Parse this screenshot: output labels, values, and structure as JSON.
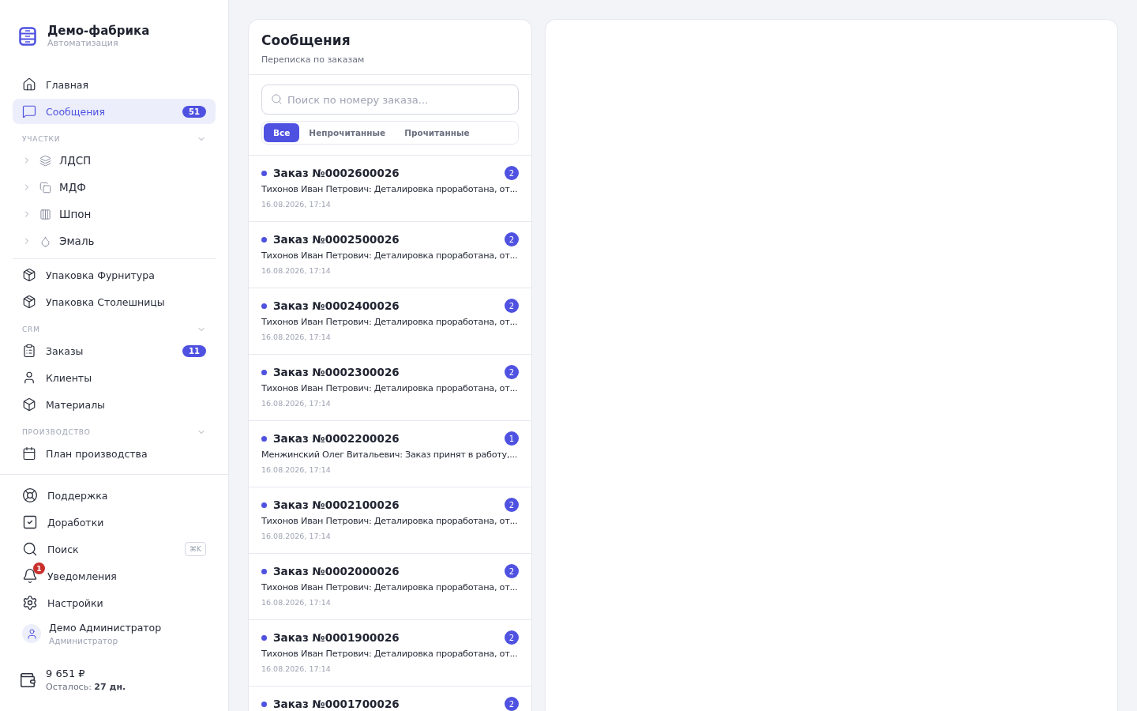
{
  "brand": {
    "title": "Демо-фабрика",
    "subtitle": "Автоматизация"
  },
  "nav": [
    {
      "label": "Главная",
      "selected": false
    },
    {
      "label": "Сообщения",
      "selected": true,
      "badge": "51"
    }
  ],
  "sections": [
    {
      "title": "УЧАСТКИ",
      "expanded": true,
      "items": [
        {
          "label": "ЛДСП",
          "expanded": false
        },
        {
          "label": "МДФ",
          "expanded": false
        },
        {
          "label": "Шпон",
          "expanded": false
        },
        {
          "label": "Эмаль",
          "expanded": false
        }
      ]
    }
  ],
  "packing": [
    {
      "label": "Упаковка Фурнитура",
      "selected": false
    },
    {
      "label": "Упаковка Столешницы",
      "selected": false
    }
  ],
  "crm": {
    "title": "CRM",
    "expanded": true,
    "items": [
      {
        "label": "Заказы",
        "selected": false,
        "badge": "11"
      },
      {
        "label": "Клиенты",
        "selected": false
      },
      {
        "label": "Материалы",
        "selected": false
      }
    ]
  },
  "production": {
    "title": "ПРОИЗВОДСТВО",
    "expanded": true,
    "items": [
      {
        "label": "План производства",
        "selected": false
      }
    ]
  },
  "bottom": [
    {
      "label": "Поддержка"
    },
    {
      "label": "Доработки"
    },
    {
      "label": "Поиск",
      "shortcut": "⌘K"
    },
    {
      "label": "Уведомления",
      "badge": "1"
    },
    {
      "label": "Настройки"
    }
  ],
  "user": {
    "name": "Демо Администратор",
    "role": "Администратор"
  },
  "balance": {
    "amount": "9 651 ₽",
    "remaining": "Осталось: **27 дн.**"
  },
  "messages": {
    "title": "Сообщения",
    "subtitle": "Переписка по заказам",
    "search": {
      "placeholder": "Поиск по номеру заказа..."
    },
    "filters": [
      {
        "label": "Все",
        "selected": true
      },
      {
        "label": "Непрочитанные",
        "selected": false
      },
      {
        "label": "Прочитанные",
        "selected": false
      }
    ],
    "conversations": [
      {
        "title": "Заказ №0002600026",
        "message": "Тихонов Иван Петрович: Деталировка проработана, от...",
        "time": "16.08.2026, 17:14",
        "count": "2",
        "unread": true
      },
      {
        "title": "Заказ №0002500026",
        "message": "Тихонов Иван Петрович: Деталировка проработана, от...",
        "time": "16.08.2026, 17:14",
        "count": "2",
        "unread": true
      },
      {
        "title": "Заказ №0002400026",
        "message": "Тихонов Иван Петрович: Деталировка проработана, от...",
        "time": "16.08.2026, 17:14",
        "count": "2",
        "unread": true
      },
      {
        "title": "Заказ №0002300026",
        "message": "Тихонов Иван Петрович: Деталировка проработана, от...",
        "time": "16.08.2026, 17:14",
        "count": "2",
        "unread": true
      },
      {
        "title": "Заказ №0002200026",
        "message": "Менжинский Олег Витальевич: Заказ принят в работу,...",
        "time": "16.08.2026, 17:14",
        "count": "1",
        "unread": true
      },
      {
        "title": "Заказ №0002100026",
        "message": "Тихонов Иван Петрович: Деталировка проработана, от...",
        "time": "16.08.2026, 17:14",
        "count": "2",
        "unread": true
      },
      {
        "title": "Заказ №0002000026",
        "message": "Тихонов Иван Петрович: Деталировка проработана, от...",
        "time": "16.08.2026, 17:14",
        "count": "2",
        "unread": true
      },
      {
        "title": "Заказ №0001900026",
        "message": "Тихонов Иван Петрович: Деталировка проработана, от...",
        "time": "16.08.2026, 17:14",
        "count": "2",
        "unread": true
      },
      {
        "title": "Заказ №0001700026",
        "count": "2",
        "unread": true
      }
    ]
  }
}
